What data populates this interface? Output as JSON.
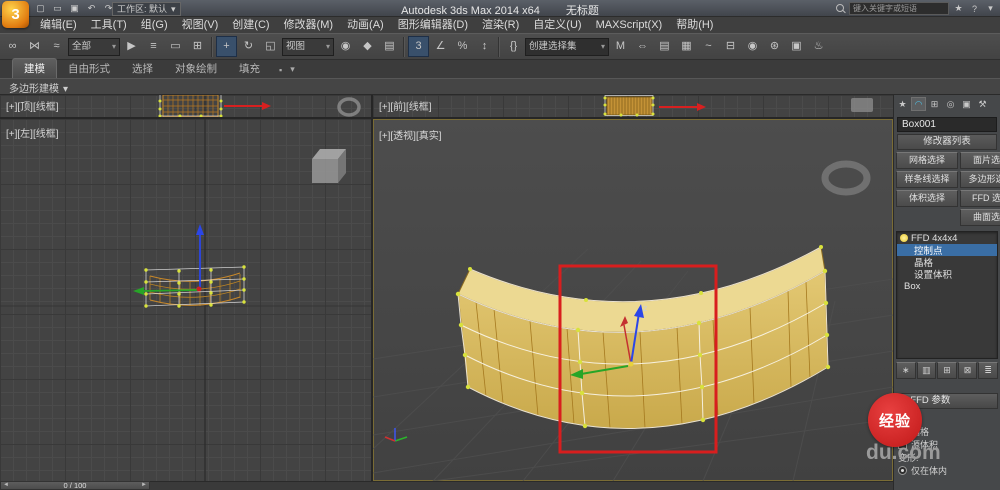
{
  "titlebar": {
    "logo_glyph": "3",
    "qat_icons": [
      {
        "name": "new-scene-icon",
        "glyph": "▢"
      },
      {
        "name": "open-file-icon",
        "glyph": "▭"
      },
      {
        "name": "save-file-icon",
        "glyph": "▣"
      },
      {
        "name": "undo-icon",
        "glyph": "↶"
      },
      {
        "name": "redo-icon",
        "glyph": "↷"
      }
    ],
    "workspace_label": "工作区: 默认",
    "dropdown_glyph": "▾",
    "app_title": "Autodesk 3ds Max 2014 x64",
    "doc_title": "无标题",
    "search_placeholder": "键入关键字或短语",
    "right_icons": [
      {
        "name": "favorites-star-icon",
        "glyph": "★"
      },
      {
        "name": "help-icon",
        "glyph": "?"
      },
      {
        "name": "titlebar-menu-icon",
        "glyph": "▾"
      }
    ]
  },
  "menus": [
    "编辑(E)",
    "工具(T)",
    "组(G)",
    "视图(V)",
    "创建(C)",
    "修改器(M)",
    "动画(A)",
    "图形编辑器(D)",
    "渲染(R)",
    "自定义(U)",
    "MAXScript(X)",
    "帮助(H)"
  ],
  "toolbar": {
    "icons": [
      {
        "name": "select-and-link-icon",
        "glyph": "∞"
      },
      {
        "name": "unlink-selection-icon",
        "glyph": "⋈"
      },
      {
        "name": "bind-to-space-warp-icon",
        "glyph": "≈"
      },
      {
        "name": "select-object-icon",
        "glyph": "▶"
      },
      {
        "name": "select-by-name-icon",
        "glyph": "≡"
      },
      {
        "name": "rectangular-selection-region-icon",
        "glyph": "▭"
      },
      {
        "name": "window-crossing-toggle-icon",
        "glyph": "⊞"
      },
      {
        "name": "select-and-move-icon",
        "glyph": "+"
      },
      {
        "name": "select-and-rotate-icon",
        "glyph": "↻"
      },
      {
        "name": "select-and-scale-icon",
        "glyph": "◱"
      },
      {
        "name": "use-pivot-center-icon",
        "glyph": "◉"
      },
      {
        "name": "select-and-manipulate-icon",
        "glyph": "◆"
      },
      {
        "name": "keyboard-shortcut-override-icon",
        "glyph": "▤"
      },
      {
        "name": "snaps-toggle-icon",
        "glyph": "3"
      },
      {
        "name": "angle-snap-icon",
        "glyph": "∠"
      },
      {
        "name": "percent-snap-icon",
        "glyph": "%"
      },
      {
        "name": "spinner-snap-icon",
        "glyph": "↕"
      },
      {
        "name": "edit-named-selection-sets-icon",
        "glyph": "{}"
      },
      {
        "name": "mirror-icon",
        "glyph": "M"
      },
      {
        "name": "align-icon",
        "glyph": "⇔"
      },
      {
        "name": "layer-manager-icon",
        "glyph": "▤"
      },
      {
        "name": "ribbon-toggle-icon",
        "glyph": "▦"
      },
      {
        "name": "curve-editor-icon",
        "glyph": "~"
      },
      {
        "name": "schematic-view-icon",
        "glyph": "⊟"
      },
      {
        "name": "material-editor-icon",
        "glyph": "◉"
      },
      {
        "name": "render-setup-icon",
        "glyph": "⊛"
      },
      {
        "name": "rendered-frame-icon",
        "glyph": "▣"
      },
      {
        "name": "render-icon",
        "glyph": "♨"
      }
    ],
    "filter_value": "全部",
    "coord_value": "视图",
    "selection_set_value": "创建选择集"
  },
  "ribbon": {
    "tabs": [
      "建模",
      "自由形式",
      "选择",
      "对象绘制",
      "填充"
    ],
    "collapse_glyph": "▪",
    "menu_glyph": "▾",
    "panel_label": "多边形建模"
  },
  "viewports": {
    "top": {
      "label": "[+][顶][线框]"
    },
    "front": {
      "label": "[+][前][线框]"
    },
    "left": {
      "label": "[+][左][线框]"
    },
    "perspective": {
      "label": "[+][透视][真实]",
      "axis_label": "z"
    }
  },
  "command_panel": {
    "tabs": [
      {
        "name": "create-tab-icon",
        "glyph": "★"
      },
      {
        "name": "modify-tab-icon",
        "glyph": "◠"
      },
      {
        "name": "hierarchy-tab-icon",
        "glyph": "⊞"
      },
      {
        "name": "motion-tab-icon",
        "glyph": "◎"
      },
      {
        "name": "display-tab-icon",
        "glyph": "▣"
      },
      {
        "name": "utilities-tab-icon",
        "glyph": "⚒"
      }
    ],
    "object_name": "Box001",
    "modifier_list_label": "修改器列表",
    "modifier_buttons": [
      "网格选择",
      "面片选择",
      "样条线选择",
      "多边形选择",
      "体积选择",
      "FFD 选择",
      "",
      "曲面选择"
    ],
    "stack_items": [
      {
        "label": "FFD 4x4x4"
      },
      {
        "label": "控制点"
      },
      {
        "label": "晶格"
      },
      {
        "label": "设置体积"
      },
      {
        "label": "Box"
      }
    ],
    "stack_tools": [
      {
        "name": "pin-stack-icon",
        "glyph": "∗"
      },
      {
        "name": "show-end-result-icon",
        "glyph": "▥"
      },
      {
        "name": "make-unique-icon",
        "glyph": "⊞"
      },
      {
        "name": "remove-modifier-icon",
        "glyph": "⊠"
      },
      {
        "name": "configure-modifier-sets-icon",
        "glyph": "≣"
      }
    ],
    "rollout_collapse_glyph": "−",
    "rollout_title": "FFD 参数",
    "params": {
      "display_label": "显示:",
      "lattice_label": "晶格",
      "source_volume_label": "源体积",
      "deform_label": "变形:",
      "only_in_volume_label": "仅在体内"
    }
  },
  "timeline": {
    "prev_glyph": "◄",
    "value": "0 / 100",
    "next_glyph": "►"
  },
  "watermark": {
    "badge": "经验",
    "domain": "du.com"
  },
  "colors": {
    "selection_red": "#d81e1e",
    "object_yellow": "#d7b75e",
    "lattice_point_yellow": "#d8e23c",
    "stack_highlight_blue": "#3a6ea5",
    "watermark_red": "#cc2222"
  }
}
